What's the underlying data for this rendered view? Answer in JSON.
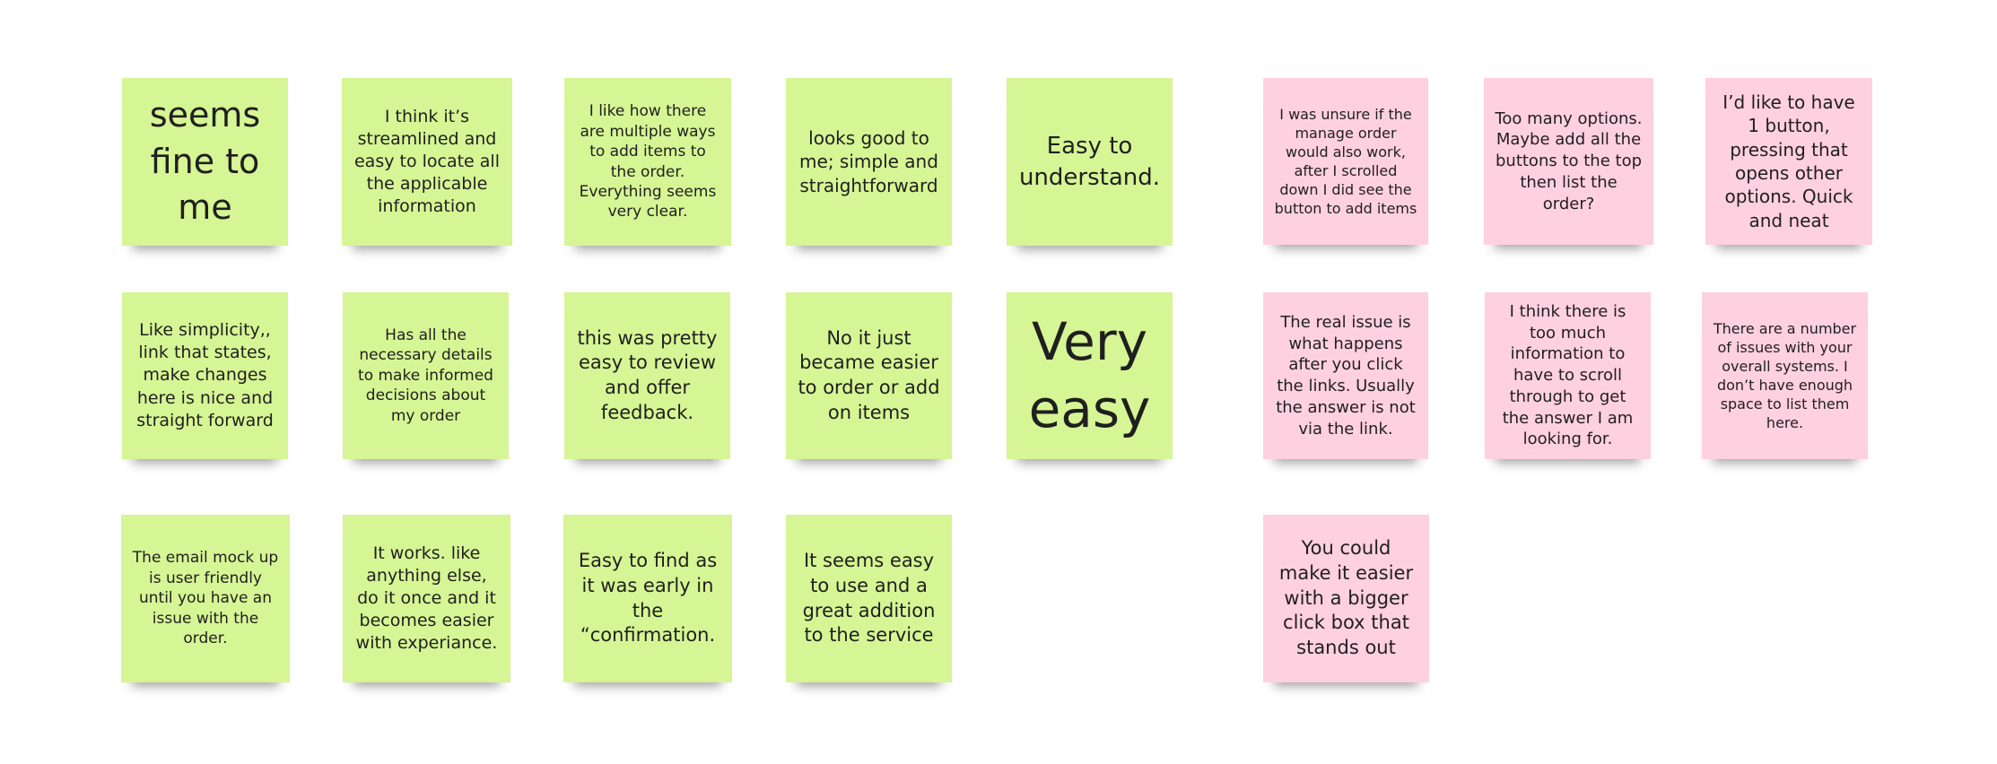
{
  "colors": {
    "positive_note": "#d6f594",
    "negative_note": "#ffd0e0",
    "background": "#ffffff"
  },
  "positive_notes": [
    "seems fine to me",
    "I think it’s streamlined and easy to locate all the applicable information",
    "I like how there are multiple ways to add items to the order. Everything seems very clear.",
    "looks good to me; simple and straightforward",
    "Easy to understand.",
    "Like simplicity,, link that states, make changes here is nice and straight forward",
    "Has all the necessary details to make informed decisions about my order",
    "this was pretty easy to review and offer feedback.",
    "No it just became easier to order or add on items",
    "Very easy",
    "The email mock up is user friendly until you have an issue with the order.",
    "It works. like anything else, do it once and it becomes easier with experiance.",
    "Easy to find as it was early in the “confirmation.",
    "It seems easy to use and a great addition to the service"
  ],
  "negative_notes": [
    "I was unsure if the manage order would also work, after I scrolled down I did see the button to add items",
    "Too many options. Maybe add all the buttons to the top then list the order?",
    "I’d like to have 1 button, pressing that opens other options. Quick and neat",
    "The real issue is what happens after you click the links. Usually the answer is not via the link.",
    "I think there is too much information to have to scroll through to get the answer I am looking for.",
    "There are a number of issues with your overall systems. I don’t have enough space to list them here.",
    "You could make it easier with a bigger click box that stands out"
  ]
}
